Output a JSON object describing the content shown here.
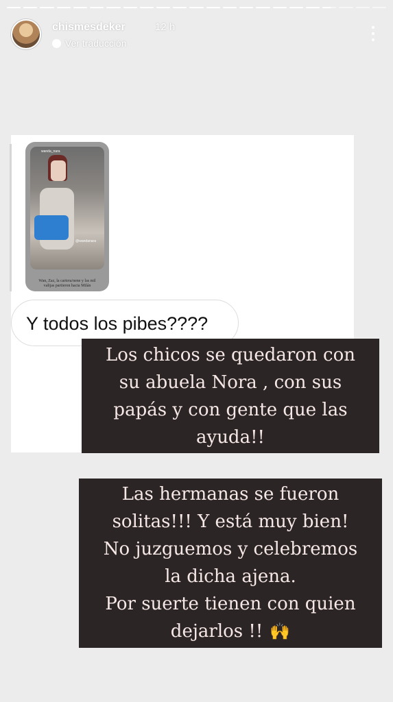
{
  "story": {
    "segments": [
      1,
      1,
      1,
      1,
      1,
      1,
      1,
      1,
      1,
      1,
      1,
      1,
      1,
      1,
      1,
      1,
      1,
      1,
      1,
      0.6,
      0,
      0,
      0
    ]
  },
  "header": {
    "username": "chismesdeker",
    "time": "12 h",
    "translate_label": "Ver traducción"
  },
  "reply": {
    "thumbnail_caption": "Wan, Zaz, la cartera/nene y las mil valijas partieron hacia Milán",
    "thumbnail_tag": "wanda_nara",
    "thumbnail_tag2": "@wandanara",
    "question": "Y todos los pibes????"
  },
  "text1": {
    "lines": [
      "Los chicos se quedaron con",
      "su abuela Nora , con sus",
      "papás y con gente que las",
      "ayuda!!"
    ]
  },
  "text2": {
    "lines": [
      "Las hermanas se fueron",
      "solitas!!! Y está muy bien!",
      "No juzguemos y celebremos",
      "la dicha ajena.",
      "Por suerte tienen con quien",
      "dejarlos !!"
    ],
    "emoji": "🙌"
  },
  "colors": {
    "background": "#ececec",
    "text_block_bg": "#2b2525",
    "text_block_fg": "#f6e8e6"
  }
}
